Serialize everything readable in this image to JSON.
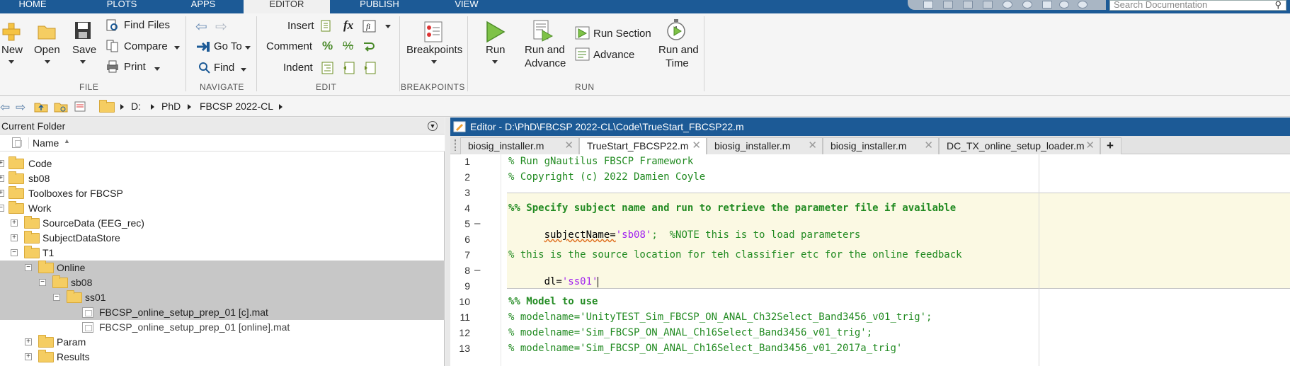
{
  "top_tabs": [
    {
      "label": "HOME"
    },
    {
      "label": "PLOTS"
    },
    {
      "label": "APPS"
    },
    {
      "label": "EDITOR"
    },
    {
      "label": "PUBLISH"
    },
    {
      "label": "VIEW"
    }
  ],
  "search": {
    "placeholder": "Search Documentation"
  },
  "ribbon": {
    "file": {
      "new": "New",
      "open": "Open",
      "save": "Save",
      "find_files": "Find Files",
      "compare": "Compare",
      "print": "Print",
      "section": "FILE"
    },
    "navigate": {
      "go_to": "Go To",
      "find": "Find",
      "section": "NAVIGATE"
    },
    "edit": {
      "insert": "Insert",
      "comment": "Comment",
      "indent": "Indent",
      "fx": "fx",
      "percent": "%",
      "section": "EDIT"
    },
    "breakpoints": {
      "label": "Breakpoints",
      "section": "BREAKPOINTS"
    },
    "run": {
      "run": "Run",
      "run_and_advance_1": "Run and",
      "run_and_advance_2": "Advance",
      "run_section": "Run Section",
      "advance": "Advance",
      "run_and_time_1": "Run and",
      "run_and_time_2": "Time",
      "section": "RUN"
    }
  },
  "address": {
    "crumbs": [
      "D:",
      "PhD",
      "FBCSP 2022-CL"
    ]
  },
  "folder_panel": {
    "title": "Current Folder",
    "column": "Name",
    "tree": [
      {
        "label": "Code",
        "expander": "+"
      },
      {
        "label": "sb08",
        "expander": "+"
      },
      {
        "label": "Toolboxes for FBCSP",
        "expander": "+"
      },
      {
        "label": "Work",
        "expander": "−"
      },
      {
        "label": "SourceData (EEG_rec)",
        "expander": "+"
      },
      {
        "label": "SubjectDataStore",
        "expander": "+"
      },
      {
        "label": "T1",
        "expander": "−"
      },
      {
        "label": "Online",
        "expander": "−"
      },
      {
        "label": "sb08",
        "expander": "−"
      },
      {
        "label": "ss01",
        "expander": "−"
      },
      {
        "label": "FBCSP_online_setup_prep_01 [c].mat",
        "expander": ""
      },
      {
        "label": "FBCSP_online_setup_prep_01 [online].mat",
        "expander": ""
      },
      {
        "label": "Param",
        "expander": "+"
      },
      {
        "label": "Results",
        "expander": "+"
      }
    ]
  },
  "editor": {
    "title": "Editor - D:\\PhD\\FBCSP 2022-CL\\Code\\TrueStart_FBCSP22.m",
    "tabs": [
      {
        "label": "biosig_installer.m"
      },
      {
        "label": "TrueStart_FBCSP22.m"
      },
      {
        "label": "biosig_installer.m"
      },
      {
        "label": "biosig_installer.m"
      },
      {
        "label": "DC_TX_online_setup_loader.m"
      }
    ],
    "new_tab": "+",
    "lines": [
      {
        "n": "1",
        "dash": "",
        "a": "% Run gNautilus FBSCP Framework",
        "b": "",
        "c": ""
      },
      {
        "n": "2",
        "dash": "",
        "a": "% Copyright (c) 2022 Damien Coyle",
        "b": "",
        "c": ""
      },
      {
        "n": "3",
        "dash": "",
        "a": "",
        "b": "",
        "c": ""
      },
      {
        "n": "4",
        "dash": "",
        "a": "%% Specify subject name and run to retrieve the parameter file if available",
        "b": "",
        "c": ""
      },
      {
        "n": "5",
        "dash": "–",
        "a": "subjectName=",
        "b": "'sb08'",
        "c": ";  %NOTE this is to load parameters"
      },
      {
        "n": "6",
        "dash": "",
        "a": "",
        "b": "",
        "c": ""
      },
      {
        "n": "7",
        "dash": "",
        "a": "% this is the source location for teh classifier etc for the online feedback",
        "b": "",
        "c": ""
      },
      {
        "n": "8",
        "dash": "–",
        "a": "dl=",
        "b": "'ss01'",
        "c": ""
      },
      {
        "n": "9",
        "dash": "",
        "a": "",
        "b": "",
        "c": ""
      },
      {
        "n": "10",
        "dash": "",
        "a": "%% Model to use",
        "b": "",
        "c": ""
      },
      {
        "n": "11",
        "dash": "",
        "a": "% modelname='UnityTEST_Sim_FBCSP_ON_ANAL_Ch32Select_Band3456_v01_trig';",
        "b": "",
        "c": ""
      },
      {
        "n": "12",
        "dash": "",
        "a": "% modelname='Sim_FBCSP_ON_ANAL_Ch16Select_Band3456_v01_trig';",
        "b": "",
        "c": ""
      },
      {
        "n": "13",
        "dash": "",
        "a": "% modelname='Sim_FBCSP_ON_ANAL_Ch16Select_Band3456_v01_2017a_trig'",
        "b": "",
        "c": ""
      }
    ]
  },
  "colors": {
    "accent": "#1c5a96",
    "comment": "#228b22",
    "string": "#a020f0",
    "cell_bg": "#fbf9e3",
    "selection": "#c7c7c7"
  }
}
